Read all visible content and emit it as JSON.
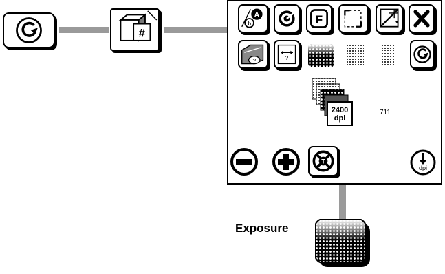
{
  "flow": {
    "start_icon": "refresh-circle-icon",
    "hash_icon": "hash-box-icon"
  },
  "panel": {
    "row1_icons": [
      "ab-letters-icon",
      "spiral-badge-icon",
      "f-letter-icon",
      "page-frame-icon",
      "diagonal-crop-icon",
      "close-icon"
    ],
    "row2_icons": [
      "folder-question-icon",
      "width-arrows-icon",
      "screen-halftone-icon",
      "coarse-halftone-icon",
      "fine-halftone-icon",
      "refresh-circle-icon"
    ],
    "stack": {
      "resolution_value": "2400",
      "resolution_unit": "dpi",
      "count": "711"
    },
    "bottom_icons": [
      "minus-icon",
      "plus-icon",
      "lifebuoy-t-icon",
      "dpi-down-icon"
    ],
    "dpi_down_unit": "dpi"
  },
  "exposure": {
    "label": "Exposure",
    "icon": "halftone-exposure-icon"
  }
}
